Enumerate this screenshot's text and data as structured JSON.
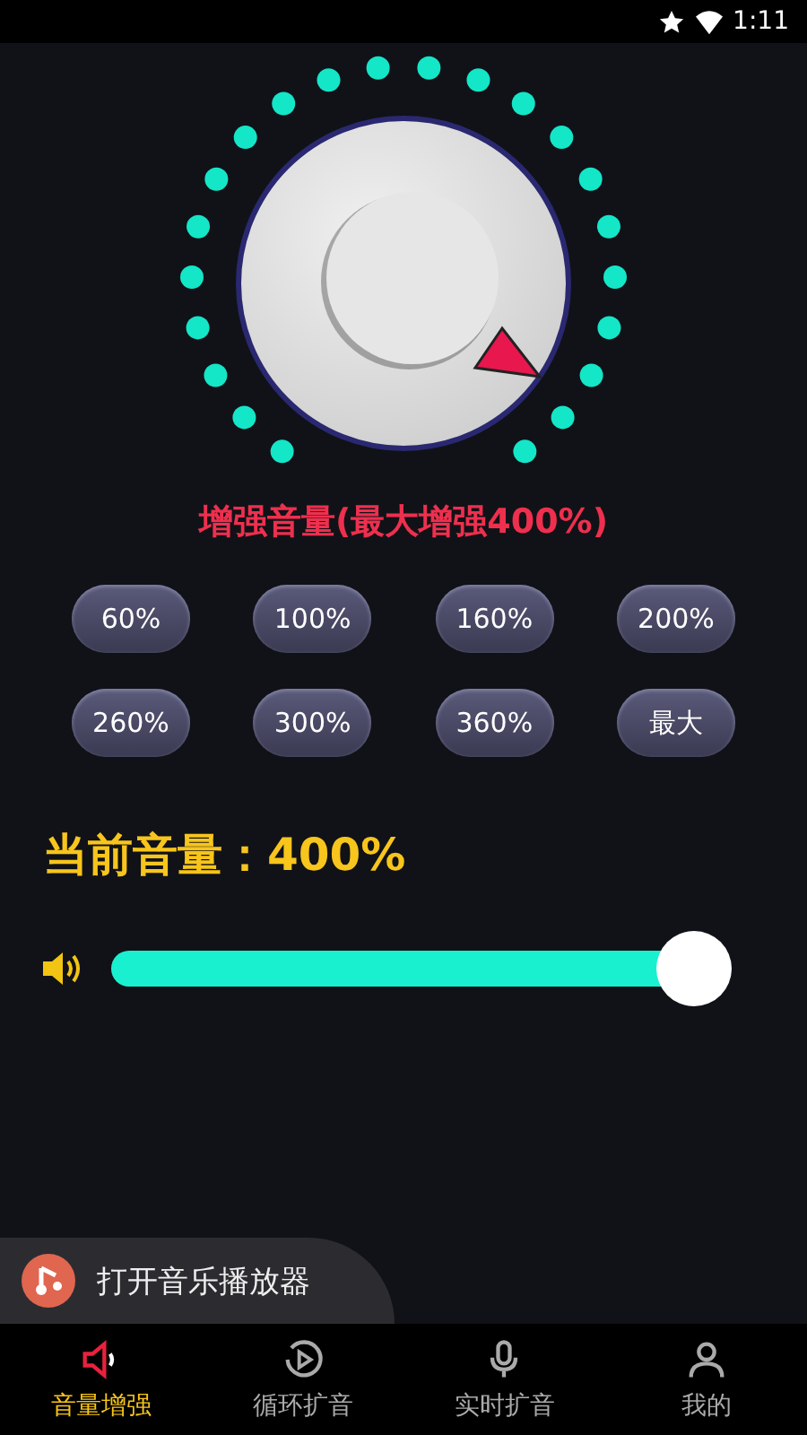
{
  "status_bar": {
    "time": "1:11"
  },
  "boost_title": "增强音量(最大增强400%)",
  "presets": [
    {
      "label": "60%"
    },
    {
      "label": "100%"
    },
    {
      "label": "160%"
    },
    {
      "label": "200%"
    },
    {
      "label": "260%"
    },
    {
      "label": "300%"
    },
    {
      "label": "360%"
    },
    {
      "label": "最大"
    }
  ],
  "current_volume": {
    "label": "当前音量：",
    "value": "400%"
  },
  "volume_slider": {
    "level": 1
  },
  "player_banner": {
    "label": "打开音乐播放器"
  },
  "tabs": [
    {
      "label": "音量增强",
      "kind": "speaker",
      "selected": true
    },
    {
      "label": "循环扩音",
      "kind": "replay",
      "selected": false
    },
    {
      "label": "实时扩音",
      "kind": "mic",
      "selected": false
    },
    {
      "label": "我的",
      "kind": "person",
      "selected": false
    }
  ]
}
